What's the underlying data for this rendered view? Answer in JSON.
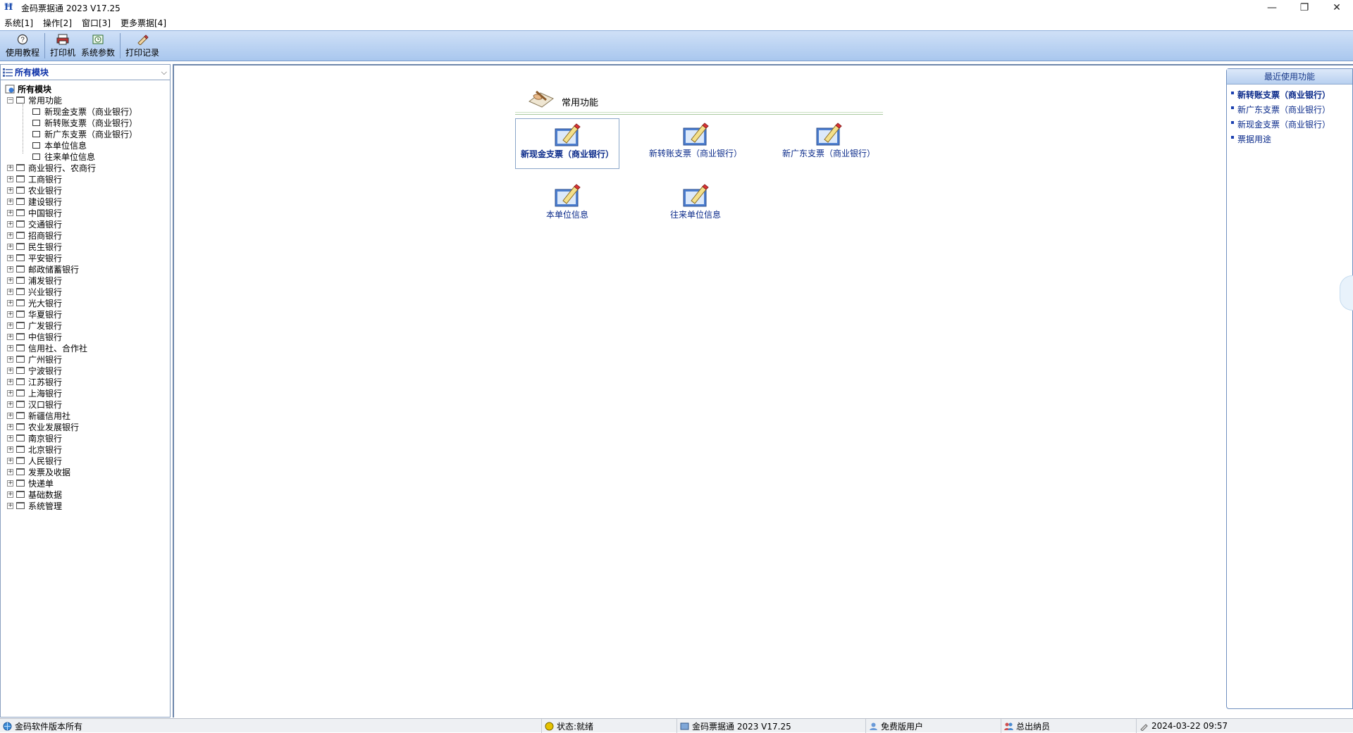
{
  "window": {
    "title": "金码票据通 2023   V17.25",
    "minimize": "—",
    "restore": "❐",
    "close": "✕"
  },
  "menu": [
    {
      "label": "系统[1]"
    },
    {
      "label": "操作[2]"
    },
    {
      "label": "窗口[3]"
    },
    {
      "label": "更多票据[4]"
    }
  ],
  "toolbar": {
    "tutorial": "使用教程",
    "printer": "打印机",
    "sys_params": "系统参数",
    "print_log": "打印记录"
  },
  "left_panel": {
    "select_value": "所有模块",
    "root": "所有模块",
    "common_group": "常用功能",
    "common_children": [
      "新现金支票（商业银行）",
      "新转账支票（商业银行）",
      "新广东支票（商业银行）",
      "本单位信息",
      "往来单位信息"
    ],
    "groups": [
      "商业银行、农商行",
      "工商银行",
      "农业银行",
      "建设银行",
      "中国银行",
      "交通银行",
      "招商银行",
      "民生银行",
      "平安银行",
      "邮政储蓄银行",
      "浦发银行",
      "兴业银行",
      "光大银行",
      "华夏银行",
      "广发银行",
      "中信银行",
      "信用社、合作社",
      "广州银行",
      "宁波银行",
      "江苏银行",
      "上海银行",
      "汉口银行",
      "新疆信用社",
      "农业发展银行",
      "南京银行",
      "北京银行",
      "人民银行",
      "发票及收据",
      "快递单",
      "基础数据",
      "系统管理"
    ]
  },
  "main": {
    "section_title": "常用功能",
    "tiles": [
      "新现金支票（商业银行）",
      "新转账支票（商业银行）",
      "新广东支票（商业银行）",
      "本单位信息",
      "往来单位信息"
    ]
  },
  "recent": {
    "header": "最近使用功能",
    "items": [
      "新转账支票（商业银行）",
      "新广东支票（商业银行）",
      "新现金支票（商业银行）",
      "票据用途"
    ]
  },
  "status": {
    "copyright": "金码软件版本所有",
    "state": "状态:就绪",
    "product": "金码票据通  2023    V17.25",
    "user_type": "免费版用户",
    "role": "总出纳员",
    "datetime": "2024-03-22  09:57"
  },
  "colors": {
    "toolbar_top": "#cfe0f7",
    "toolbar_bottom": "#a9c7ee",
    "link_blue": "#0a2a8a"
  }
}
